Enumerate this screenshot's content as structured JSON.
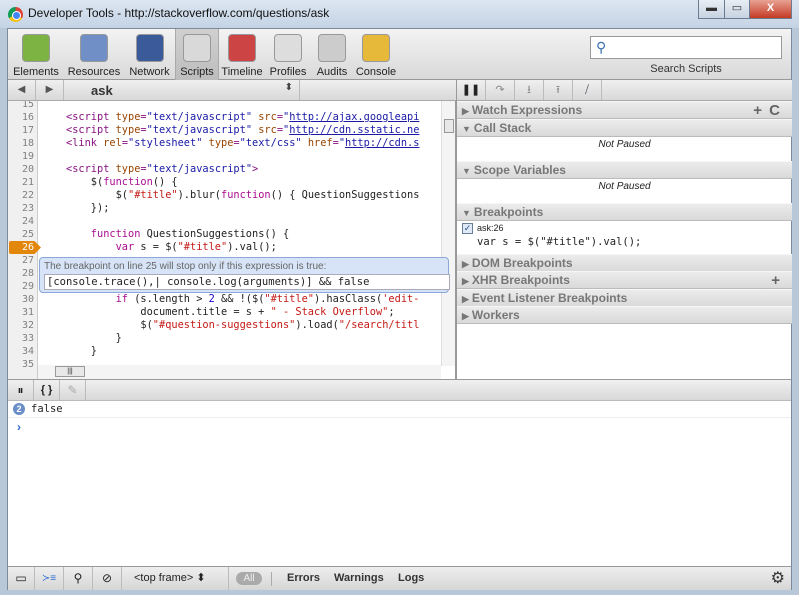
{
  "window": {
    "title": "Developer Tools - http://stackoverflow.com/questions/ask",
    "minimize": "▬",
    "maximize": "▭",
    "close": "X"
  },
  "toolbar": {
    "tabs": [
      {
        "label": "Elements",
        "color": "#7cb342"
      },
      {
        "label": "Resources",
        "color": "#6f8fc6"
      },
      {
        "label": "Network",
        "color": "#3b5a9a"
      },
      {
        "label": "Scripts",
        "color": "#d9d9d9"
      },
      {
        "label": "Timeline",
        "color": "#c44"
      },
      {
        "label": "Profiles",
        "color": "#ddd"
      },
      {
        "label": "Audits",
        "color": "#ccc"
      },
      {
        "label": "Console",
        "color": "#e7b93a"
      }
    ],
    "selected": "Scripts",
    "search_placeholder": "",
    "search_label": "Search Scripts"
  },
  "nav": {
    "back": "◀",
    "forward": "▶",
    "file": "ask",
    "file_arrows": "⬍"
  },
  "code": {
    "lines": [
      {
        "n": "15",
        "t": []
      },
      {
        "n": "16",
        "t": [
          [
            "tag",
            "<script "
          ],
          [
            "attr",
            "type"
          ],
          [
            "tag",
            "="
          ],
          [
            "str",
            "\"text/javascript\""
          ],
          [
            "attr",
            " src"
          ],
          [
            "tag",
            "="
          ],
          [
            "str",
            "\""
          ],
          [
            "url",
            "http://ajax.googleapi"
          ]
        ]
      },
      {
        "n": "17",
        "t": [
          [
            "tag",
            "<script "
          ],
          [
            "attr",
            "type"
          ],
          [
            "tag",
            "="
          ],
          [
            "str",
            "\"text/javascript\""
          ],
          [
            "attr",
            " src"
          ],
          [
            "tag",
            "="
          ],
          [
            "str",
            "\""
          ],
          [
            "url",
            "http://cdn.sstatic.ne"
          ]
        ]
      },
      {
        "n": "18",
        "t": [
          [
            "tag",
            "<link "
          ],
          [
            "attr",
            "rel"
          ],
          [
            "tag",
            "="
          ],
          [
            "str",
            "\"stylesheet\""
          ],
          [
            "attr",
            " type"
          ],
          [
            "tag",
            "="
          ],
          [
            "str",
            "\"text/css\""
          ],
          [
            "attr",
            " href"
          ],
          [
            "tag",
            "="
          ],
          [
            "str",
            "\""
          ],
          [
            "url",
            "http://cdn.s"
          ]
        ]
      },
      {
        "n": "19",
        "t": []
      },
      {
        "n": "20",
        "t": [
          [
            "tag",
            "<script "
          ],
          [
            "attr",
            "type"
          ],
          [
            "tag",
            "="
          ],
          [
            "str",
            "\"text/javascript\""
          ],
          [
            "tag",
            ">"
          ]
        ]
      },
      {
        "n": "21",
        "t": [
          [
            "js",
            "    $("
          ],
          [
            "kw",
            "function"
          ],
          [
            "js",
            "() {"
          ]
        ]
      },
      {
        "n": "22",
        "t": [
          [
            "js",
            "        $("
          ],
          [
            "jstr",
            "\"#title\""
          ],
          [
            "js",
            ").blur("
          ],
          [
            "kw",
            "function"
          ],
          [
            "js",
            "() { QuestionSuggestions"
          ]
        ]
      },
      {
        "n": "23",
        "t": [
          [
            "js",
            "    });"
          ]
        ]
      },
      {
        "n": "24",
        "t": []
      },
      {
        "n": "25",
        "t": [
          [
            "kw",
            "    function"
          ],
          [
            "js",
            " QuestionSuggestions() {"
          ]
        ]
      },
      {
        "n": "26",
        "t": [
          [
            "kw",
            "        var"
          ],
          [
            "js",
            " s = $("
          ],
          [
            "jstr",
            "\"#title\""
          ],
          [
            "js",
            ").val();"
          ]
        ],
        "bp": true
      },
      {
        "n": "27",
        "t": []
      },
      {
        "n": "28",
        "t": []
      },
      {
        "n": "29",
        "t": []
      },
      {
        "n": "30",
        "t": [
          [
            "kw",
            "        if"
          ],
          [
            "js",
            " (s.length > "
          ],
          [
            "num",
            "2"
          ],
          [
            "js",
            " && !($("
          ],
          [
            "jstr",
            "\"#title\""
          ],
          [
            "js",
            ").hasClass("
          ],
          [
            "jstr",
            "'edit-"
          ]
        ]
      },
      {
        "n": "31",
        "t": [
          [
            "js",
            "            document.title = s + "
          ],
          [
            "jstr",
            "\" - Stack Overflow\""
          ],
          [
            "js",
            ";"
          ]
        ]
      },
      {
        "n": "32",
        "t": [
          [
            "js",
            "            $("
          ],
          [
            "jstr",
            "\"#question-suggestions\""
          ],
          [
            "js",
            ").load("
          ],
          [
            "jstr",
            "\"/search/titl"
          ]
        ]
      },
      {
        "n": "33",
        "t": [
          [
            "js",
            "        }"
          ]
        ]
      },
      {
        "n": "34",
        "t": [
          [
            "js",
            "    }"
          ]
        ]
      },
      {
        "n": "35",
        "t": []
      }
    ],
    "condition_popup": {
      "label": "The breakpoint on line 25 will stop only if this expression is true:",
      "value": "[console.trace(),| console.log(arguments)] && false"
    }
  },
  "debugger": {
    "buttons": [
      "❚❚",
      "↷",
      "⭳",
      "⭱",
      "⧸"
    ],
    "sections": [
      {
        "label": "Watch Expressions",
        "expanded": false
      },
      {
        "label": "Call Stack",
        "expanded": true,
        "content": "Not Paused"
      },
      {
        "label": "Scope Variables",
        "expanded": true,
        "content": "Not Paused"
      },
      {
        "label": "Breakpoints",
        "expanded": true
      },
      {
        "label": "DOM Breakpoints",
        "expanded": false
      },
      {
        "label": "XHR Breakpoints",
        "expanded": false
      },
      {
        "label": "Event Listener Breakpoints",
        "expanded": false
      },
      {
        "label": "Workers",
        "expanded": false
      }
    ],
    "watch_add": "+",
    "watch_refresh": "C",
    "xhr_add": "+",
    "breakpoint": {
      "checked": true,
      "check": "✓",
      "location": "ask:26",
      "code": "var s = $(\"#title\").val();"
    }
  },
  "console_toolbar": {
    "pause": "⏸",
    "pretty": "{ }",
    "edit": "✎"
  },
  "console": {
    "count": "2",
    "value": "false",
    "prompt": "›"
  },
  "statusbar": {
    "dock": "▭",
    "console": "≻≡",
    "search": "⚲",
    "clear": "⊘",
    "frame": "<top frame>",
    "frame_arrows": "⬍",
    "filters": [
      "All",
      "Errors",
      "Warnings",
      "Logs"
    ],
    "gear": "⚙"
  }
}
